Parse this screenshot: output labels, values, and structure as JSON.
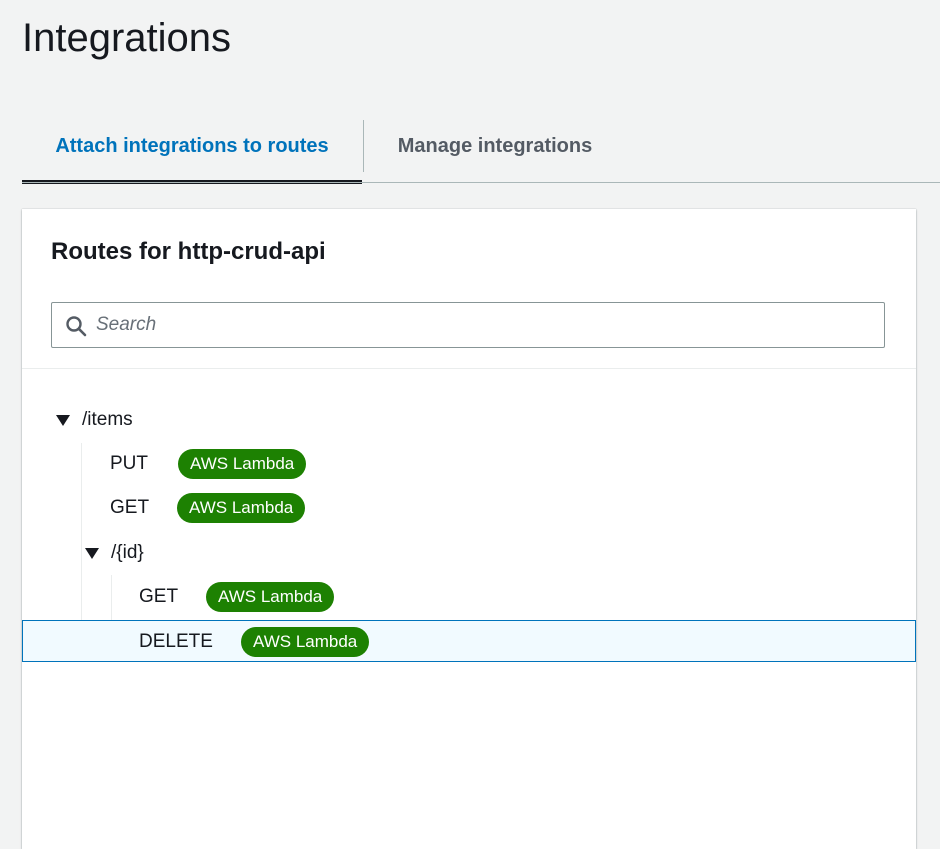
{
  "page": {
    "title": "Integrations"
  },
  "tabs": [
    {
      "label": "Attach integrations to routes",
      "active": true
    },
    {
      "label": "Manage integrations",
      "active": false
    }
  ],
  "routes_panel": {
    "title": "Routes for http-crud-api",
    "search": {
      "placeholder": "Search",
      "value": ""
    },
    "tree": [
      {
        "label": "/items",
        "expanded": true
      },
      {
        "method": "PUT",
        "integration": "AWS Lambda"
      },
      {
        "method": "GET",
        "integration": "AWS Lambda"
      },
      {
        "label": "/{id}",
        "expanded": true
      },
      {
        "method": "GET",
        "integration": "AWS Lambda"
      },
      {
        "method": "DELETE",
        "integration": "AWS Lambda",
        "selected": true
      }
    ]
  },
  "colors": {
    "active_tab": "#0073bb",
    "badge_green": "#1d8102",
    "selected_row_border": "#0073bb",
    "selected_row_bg": "#f1faff"
  },
  "icons": {
    "search": "search-icon",
    "expand": "caret-down-icon"
  }
}
